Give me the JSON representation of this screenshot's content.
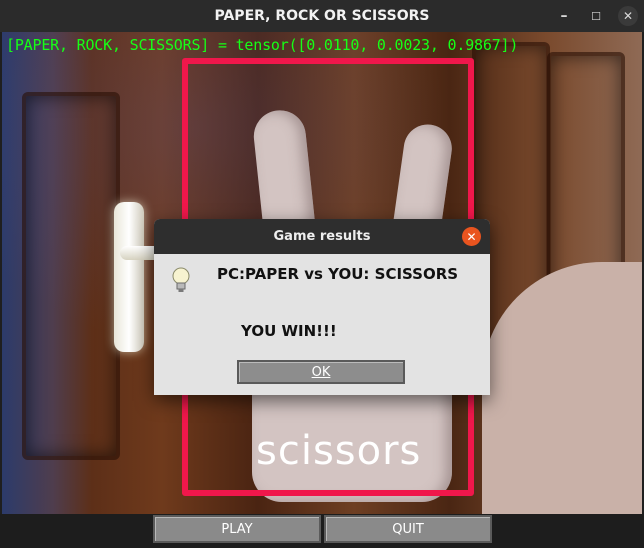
{
  "window": {
    "title": "PAPER, ROCK OR SCISSORS",
    "minimize_label": "–",
    "maximize_label": "☐",
    "close_label": "✕"
  },
  "webcam": {
    "detection_text": "[PAPER, ROCK, SCISSORS] = tensor([0.0110, 0.0023, 0.9867])",
    "prediction_label": "scissors",
    "roi_color": "#f0174b",
    "detection_text_color": "#16ff16"
  },
  "dialog": {
    "title": "Game results",
    "close_label": "✕",
    "icon": "lightbulb-icon",
    "message_line1": "PC:PAPER vs YOU: SCISSORS",
    "message_line2": "YOU WIN!!!",
    "ok_label": "OK"
  },
  "controls": {
    "play_label": "PLAY",
    "quit_label": "QUIT"
  }
}
